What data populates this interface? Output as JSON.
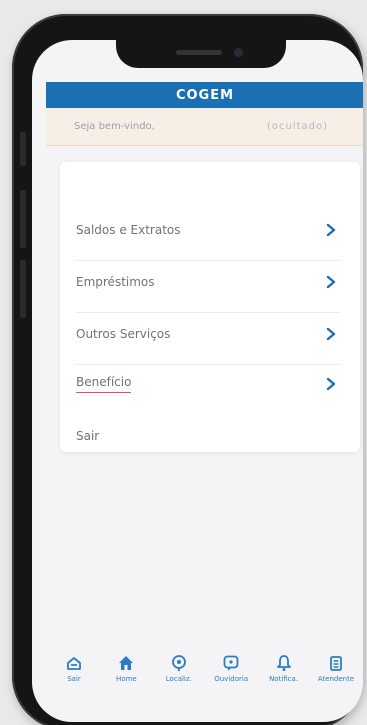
{
  "header": {
    "title": "COGEM"
  },
  "welcome": {
    "text": "Seja bem-vindo,",
    "code": "(ocultado)"
  },
  "menu": {
    "items": [
      {
        "label": "Saldos e Extratos",
        "has_chevron": true
      },
      {
        "label": "Empréstimos",
        "has_chevron": true
      },
      {
        "label": "Outros Serviços",
        "has_chevron": true
      },
      {
        "label": "Benefício",
        "has_chevron": true
      },
      {
        "label": "Sair",
        "has_chevron": false
      }
    ]
  },
  "tabbar": {
    "tabs": [
      {
        "label": "Sair",
        "icon": "logout-icon"
      },
      {
        "label": "Home",
        "icon": "home-icon"
      },
      {
        "label": "Localiz.",
        "icon": "location-icon"
      },
      {
        "label": "Ouvidoria",
        "icon": "chat-icon"
      },
      {
        "label": "Notifica.",
        "icon": "bell-icon"
      },
      {
        "label": "Atendente",
        "icon": "support-icon"
      }
    ]
  },
  "colors": {
    "brand": "#1b6fb3",
    "accent_underline": "#e0525c",
    "tab_icon": "#2b7cc2"
  }
}
